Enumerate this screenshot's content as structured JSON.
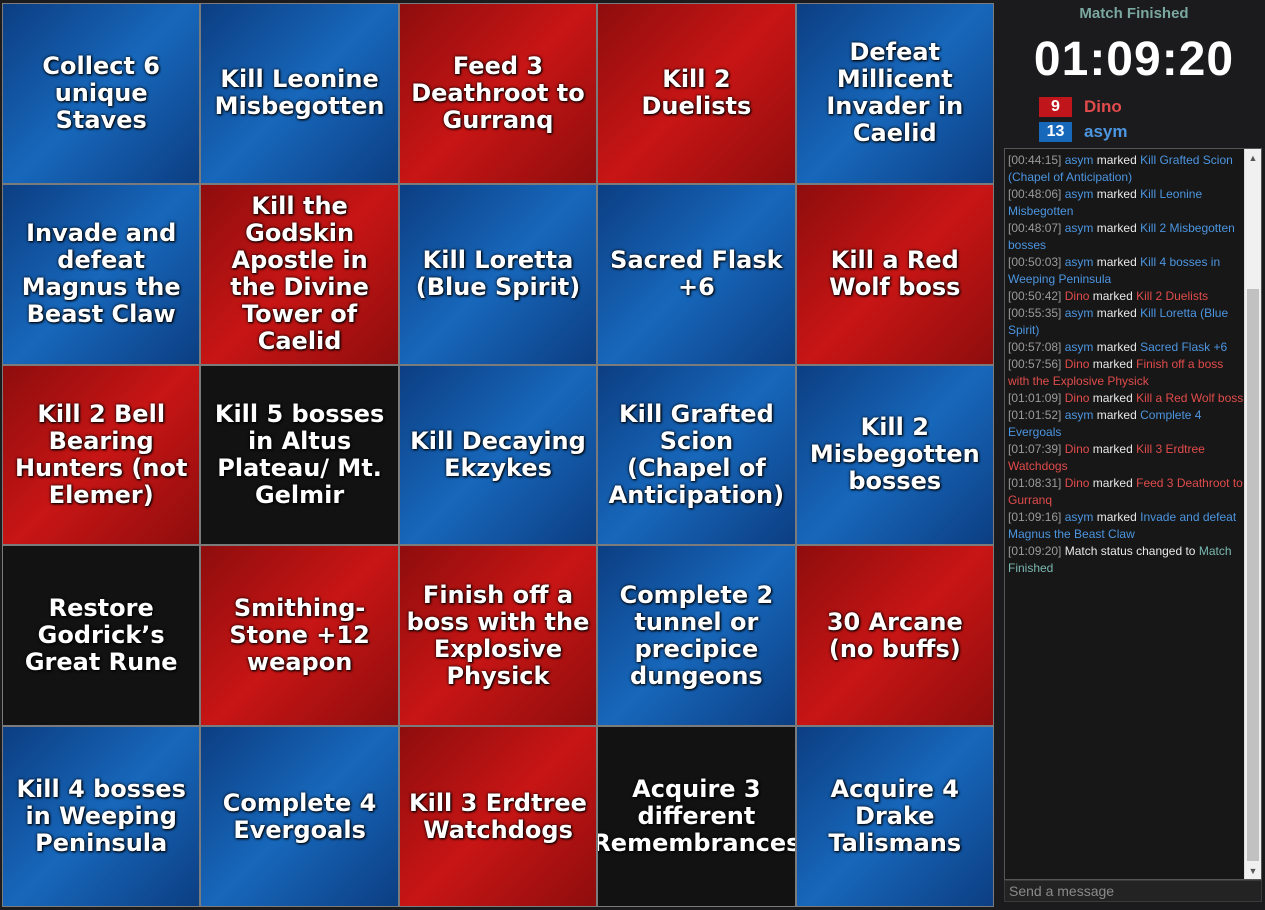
{
  "board": {
    "cells": [
      {
        "text": "Collect 6 unique Staves",
        "color": "blue"
      },
      {
        "text": "Kill Leonine Misbegotten",
        "color": "blue"
      },
      {
        "text": "Feed 3 Deathroot to Gurranq",
        "color": "red"
      },
      {
        "text": "Kill 2 Duelists",
        "color": "red"
      },
      {
        "text": "Defeat Millicent Invader in Caelid",
        "color": "blue"
      },
      {
        "text": "Invade and defeat Magnus the Beast Claw",
        "color": "blue"
      },
      {
        "text": "Kill the Godskin Apostle in the Divine Tower of Caelid",
        "color": "red"
      },
      {
        "text": "Kill Loretta (Blue Spirit)",
        "color": "blue"
      },
      {
        "text": "Sacred Flask +6",
        "color": "blue"
      },
      {
        "text": "Kill a Red Wolf boss",
        "color": "red"
      },
      {
        "text": "Kill 2 Bell Bearing Hunters (not Elemer)",
        "color": "red"
      },
      {
        "text": "Kill 5 bosses in Altus Plateau/ Mt. Gelmir",
        "color": "black"
      },
      {
        "text": "Kill Decaying Ekzykes",
        "color": "blue"
      },
      {
        "text": "Kill Grafted Scion (Chapel of Anticipation)",
        "color": "blue"
      },
      {
        "text": "Kill 2 Misbegotten bosses",
        "color": "blue"
      },
      {
        "text": "Restore Godrick’s Great Rune",
        "color": "black"
      },
      {
        "text": "Smithing-Stone +12 weapon",
        "color": "red"
      },
      {
        "text": "Finish off a boss with the Explosive Physick",
        "color": "red"
      },
      {
        "text": "Complete 2 tunnel or precipice dungeons",
        "color": "blue"
      },
      {
        "text": "30 Arcane (no buffs)",
        "color": "red"
      },
      {
        "text": "Kill 4 bosses in Weeping Peninsula",
        "color": "blue"
      },
      {
        "text": "Complete 4 Evergoals",
        "color": "blue"
      },
      {
        "text": "Kill 3 Erdtree Watchdogs",
        "color": "red"
      },
      {
        "text": "Acquire 3 different Remembrances",
        "color": "black"
      },
      {
        "text": "Acquire 4 Drake Talismans",
        "color": "blue"
      }
    ]
  },
  "sidebar": {
    "status": "Match Finished",
    "timer": "01:09:20",
    "players": [
      {
        "score": "9",
        "name": "Dino",
        "color": "#e14b4b",
        "box_color": "#c0161b"
      },
      {
        "score": "13",
        "name": "asym",
        "color": "#4c95e0",
        "box_color": "#1767bb"
      }
    ]
  },
  "chat": {
    "messages": [
      {
        "ts": "[00:44:15]",
        "player": "asym",
        "team": "blue",
        "action": "marked",
        "goal": "Kill Grafted Scion (Chapel of Anticipation)"
      },
      {
        "ts": "[00:48:06]",
        "player": "asym",
        "team": "blue",
        "action": "marked",
        "goal": "Kill Leonine Misbegotten"
      },
      {
        "ts": "[00:48:07]",
        "player": "asym",
        "team": "blue",
        "action": "marked",
        "goal": "Kill 2 Misbegotten bosses"
      },
      {
        "ts": "[00:50:03]",
        "player": "asym",
        "team": "blue",
        "action": "marked",
        "goal": "Kill 4 bosses in Weeping Peninsula"
      },
      {
        "ts": "[00:50:42]",
        "player": "Dino",
        "team": "red",
        "action": "marked",
        "goal": "Kill 2 Duelists"
      },
      {
        "ts": "[00:55:35]",
        "player": "asym",
        "team": "blue",
        "action": "marked",
        "goal": "Kill Loretta (Blue Spirit)"
      },
      {
        "ts": "[00:57:08]",
        "player": "asym",
        "team": "blue",
        "action": "marked",
        "goal": "Sacred Flask +6"
      },
      {
        "ts": "[00:57:56]",
        "player": "Dino",
        "team": "red",
        "action": "marked",
        "goal": "Finish off a boss with the Explosive Physick"
      },
      {
        "ts": "[01:01:09]",
        "player": "Dino",
        "team": "red",
        "action": "marked",
        "goal": "Kill a Red Wolf boss"
      },
      {
        "ts": "[01:01:52]",
        "player": "asym",
        "team": "blue",
        "action": "marked",
        "goal": "Complete 4 Evergoals"
      },
      {
        "ts": "[01:07:39]",
        "player": "Dino",
        "team": "red",
        "action": "marked",
        "goal": "Kill 3 Erdtree Watchdogs"
      },
      {
        "ts": "[01:08:31]",
        "player": "Dino",
        "team": "red",
        "action": "marked",
        "goal": "Feed 3 Deathroot to Gurranq"
      },
      {
        "ts": "[01:09:16]",
        "player": "asym",
        "team": "blue",
        "action": "marked",
        "goal": "Invade and defeat Magnus the Beast Claw"
      },
      {
        "ts": "[01:09:20]",
        "player": "",
        "team": "status",
        "action": "Match status changed to",
        "goal": "Match Finished"
      }
    ],
    "input_placeholder": "Send a message",
    "scroll_up_icon": "▲",
    "scroll_down_icon": "▼"
  }
}
